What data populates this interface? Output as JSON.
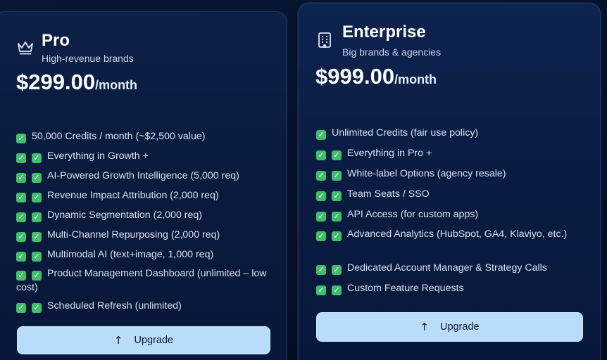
{
  "plans": [
    {
      "icon": "crown-icon",
      "name": "Pro",
      "subtitle": "High-revenue brands",
      "price": "$299.00",
      "period": "/month",
      "features": [
        {
          "checks": 1,
          "text": "50,000 Credits / month (~$2,500 value)"
        },
        {
          "checks": 2,
          "text": "Everything in Growth +"
        },
        {
          "checks": 2,
          "text": "AI-Powered Growth Intelligence (5,000 req)"
        },
        {
          "checks": 2,
          "text": "Revenue Impact Attribution (2,000 req)"
        },
        {
          "checks": 2,
          "text": "Dynamic Segmentation (2,000 req)"
        },
        {
          "checks": 2,
          "text": "Multi-Channel Repurposing (2,000 req)"
        },
        {
          "checks": 2,
          "text": "Multimodal AI (text+image, 1,000 req)"
        },
        {
          "checks": 2,
          "text": "Product Management Dashboard (unlimited – low cost)"
        },
        {
          "checks": 2,
          "text": "Scheduled Refresh (unlimited)"
        }
      ],
      "button_label": "Upgrade",
      "button_icon": "arrow-up-icon"
    },
    {
      "icon": "building-icon",
      "name": "Enterprise",
      "subtitle": "Big brands & agencies",
      "price": "$999.00",
      "period": "/month",
      "features": [
        {
          "checks": 1,
          "text": "Unlimited Credits (fair use policy)"
        },
        {
          "checks": 2,
          "text": "Everything in Pro +"
        },
        {
          "checks": 2,
          "text": "White-label Options (agency resale)"
        },
        {
          "checks": 2,
          "text": "Team Seats / SSO"
        },
        {
          "checks": 2,
          "text": "API Access (for custom apps)"
        },
        {
          "checks": 2,
          "text": "Advanced Analytics (HubSpot, GA4, Klaviyo, etc.)"
        },
        {
          "checks": 2,
          "text": "Dedicated Account Manager & Strategy Calls"
        },
        {
          "checks": 2,
          "text": "Custom Feature Requests"
        }
      ],
      "button_label": "Upgrade",
      "button_icon": "arrow-up-icon"
    }
  ],
  "colors": {
    "background": "#06122a",
    "check": "#3fbf6a",
    "button": "#b9dcfb",
    "text": "#d8e2f2"
  }
}
